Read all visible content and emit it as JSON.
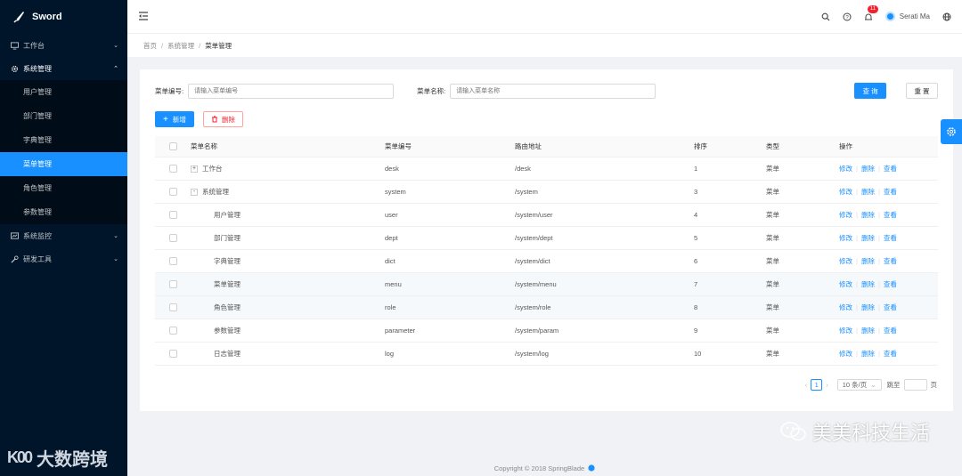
{
  "app": {
    "name": "Sword"
  },
  "sidebar": {
    "groups": [
      {
        "label": "工作台",
        "icon": "monitor-icon",
        "expanded": false
      },
      {
        "label": "系统管理",
        "icon": "gear-icon",
        "expanded": true,
        "items": [
          {
            "label": "用户管理",
            "active": false
          },
          {
            "label": "部门管理",
            "active": false
          },
          {
            "label": "字典管理",
            "active": false
          },
          {
            "label": "菜单管理",
            "active": true
          },
          {
            "label": "角色管理",
            "active": false
          },
          {
            "label": "参数管理",
            "active": false
          }
        ]
      },
      {
        "label": "系统监控",
        "icon": "monitor-icon",
        "expanded": false
      },
      {
        "label": "研发工具",
        "icon": "tool-icon",
        "expanded": false
      }
    ]
  },
  "header": {
    "notification_count": "11",
    "username": "Serati Ma"
  },
  "breadcrumb": {
    "items": [
      "首页",
      "系统管理",
      "菜单管理"
    ]
  },
  "search": {
    "name_label": "菜单编号:",
    "name_placeholder": "请输入菜单编号",
    "code_label": "菜单名称:",
    "code_placeholder": "请输入菜单名称",
    "query_label": "查 询",
    "reset_label": "重 置"
  },
  "toolbar": {
    "add_label": "新增",
    "delete_label": "删除"
  },
  "table": {
    "headers": [
      "菜单名称",
      "菜单编号",
      "路由地址",
      "排序",
      "类型",
      "操作"
    ],
    "ops": [
      "修改",
      "删除",
      "查看"
    ],
    "rows": [
      {
        "name": "工作台",
        "code": "desk",
        "path": "/desk",
        "sort": "1",
        "type": "菜单",
        "expand": "+",
        "level": 0,
        "highlight": false
      },
      {
        "name": "系统管理",
        "code": "system",
        "path": "/system",
        "sort": "3",
        "type": "菜单",
        "expand": "-",
        "level": 0,
        "highlight": false
      },
      {
        "name": "用户管理",
        "code": "user",
        "path": "/system/user",
        "sort": "4",
        "type": "菜单",
        "expand": "",
        "level": 1,
        "highlight": false
      },
      {
        "name": "部门管理",
        "code": "dept",
        "path": "/system/dept",
        "sort": "5",
        "type": "菜单",
        "expand": "",
        "level": 1,
        "highlight": false
      },
      {
        "name": "字典管理",
        "code": "dict",
        "path": "/system/dict",
        "sort": "6",
        "type": "菜单",
        "expand": "",
        "level": 1,
        "highlight": false
      },
      {
        "name": "菜单管理",
        "code": "menu",
        "path": "/system/menu",
        "sort": "7",
        "type": "菜单",
        "expand": "",
        "level": 1,
        "highlight": true
      },
      {
        "name": "角色管理",
        "code": "role",
        "path": "/system/role",
        "sort": "8",
        "type": "菜单",
        "expand": "",
        "level": 1,
        "highlight": true
      },
      {
        "name": "参数管理",
        "code": "parameter",
        "path": "/system/param",
        "sort": "9",
        "type": "菜单",
        "expand": "",
        "level": 1,
        "highlight": false
      },
      {
        "name": "日志管理",
        "code": "log",
        "path": "/system/log",
        "sort": "10",
        "type": "菜单",
        "expand": "",
        "level": 1,
        "highlight": false
      }
    ]
  },
  "pagination": {
    "current_page": "1",
    "page_size": "10 条/页",
    "jump_label": "跳至",
    "page_suffix": "页"
  },
  "footer": {
    "copyright": "Copyright © 2018 SpringBlade"
  },
  "watermarks": {
    "left": "大数跨境",
    "left_logo": "K00",
    "right": "美美科技生活"
  },
  "colors": {
    "sidebar_bg": "#001529",
    "accent": "#1890ff",
    "danger": "#f5222d"
  }
}
